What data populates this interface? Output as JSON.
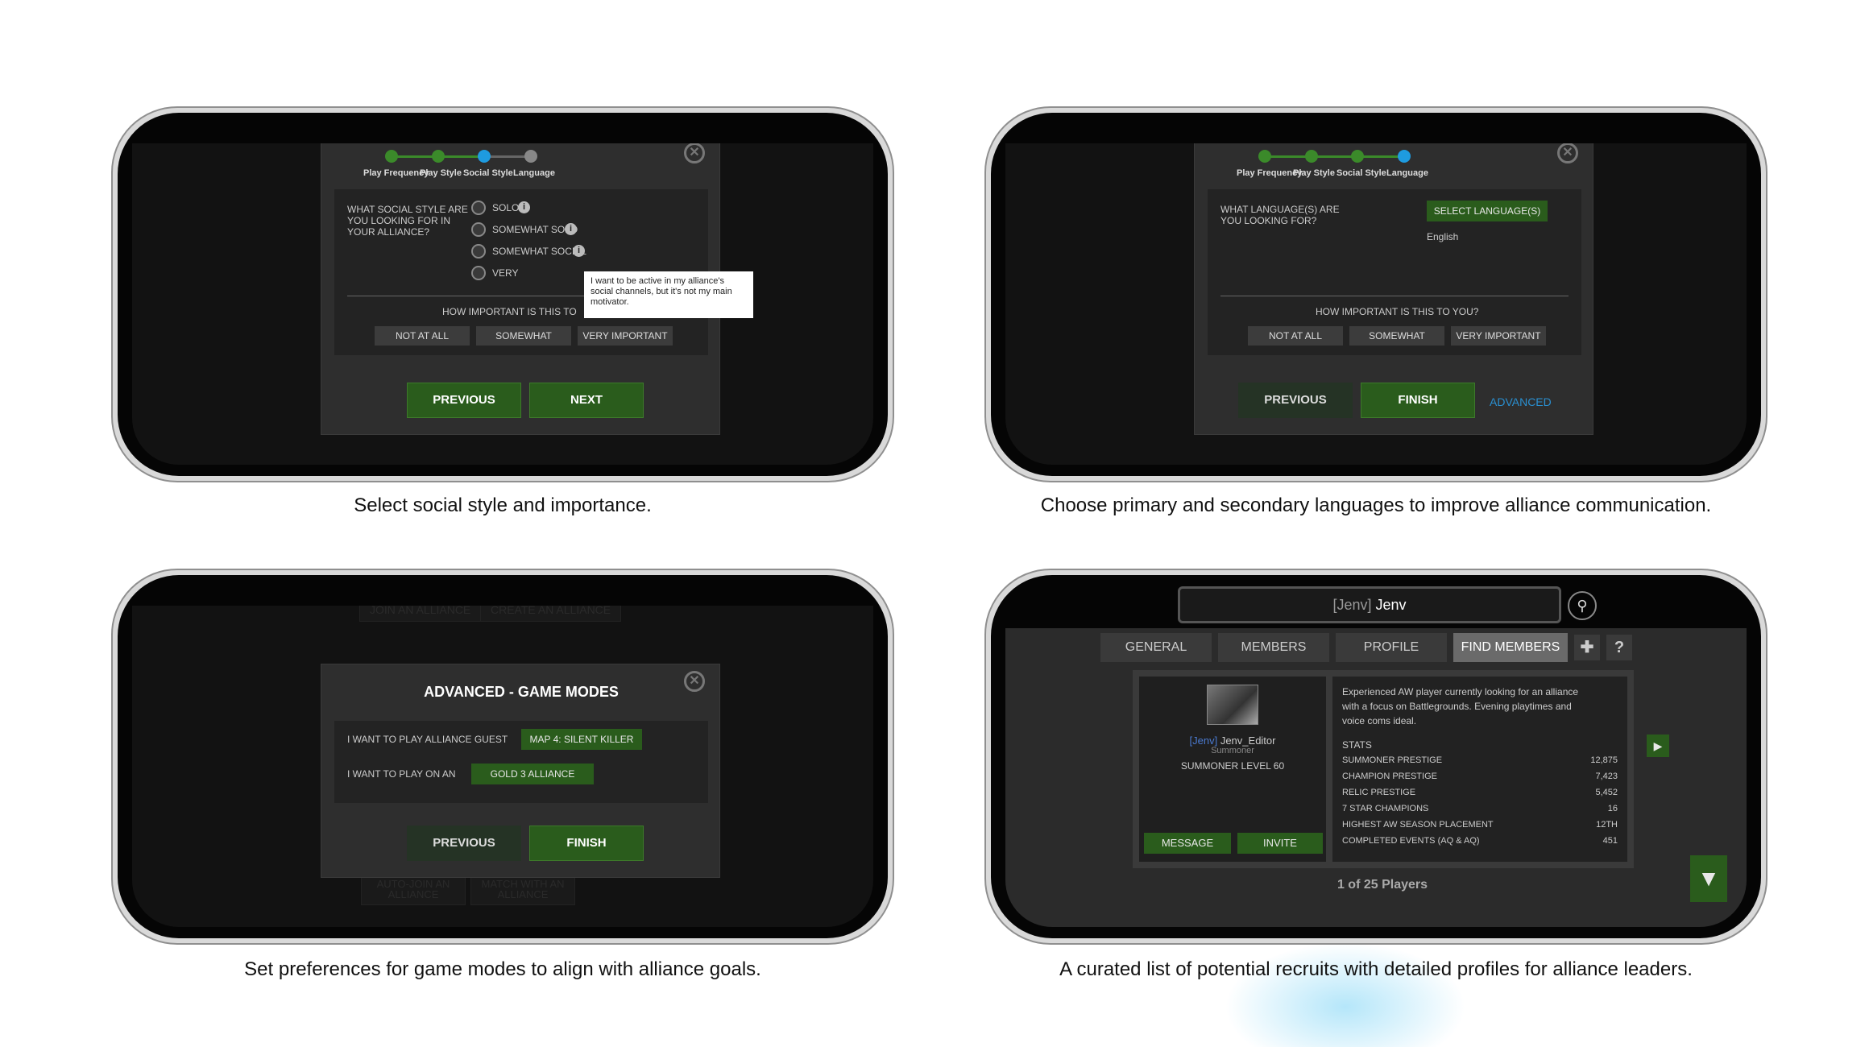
{
  "captions": [
    "Select social style and importance.",
    "Choose primary and secondary languages to improve alliance communication.",
    "Set preferences for game modes to align with alliance goals.",
    "A curated list of potential recruits with detailed profiles for alliance leaders."
  ],
  "background_tabs": {
    "join": "JOIN AN ALLIANCE",
    "create": "CREATE AN ALLIANCE",
    "auto_join": "AUTO-JOIN AN ALLIANCE",
    "match": "MATCH WITH AN ALLIANCE"
  },
  "steps": [
    "Play Frequency",
    "Play Style",
    "Social Style",
    "Language"
  ],
  "social": {
    "question": "WHAT SOCIAL STYLE ARE YOU LOOKING FOR IN YOUR ALLIANCE?",
    "options": [
      "SOLO",
      "SOMEWHAT SOLO",
      "SOMEWHAT SOCIAL",
      "VERY"
    ],
    "tooltip": "I want to be active in my alliance's social channels, but it's not my main motivator.",
    "importance_label": "HOW IMPORTANT IS THIS TO",
    "importance": [
      "NOT AT ALL",
      "SOMEWHAT",
      "VERY IMPORTANT"
    ],
    "previous": "PREVIOUS",
    "next": "NEXT"
  },
  "language": {
    "question": "WHAT LANGUAGE(S) ARE YOU LOOKING FOR?",
    "select_button": "SELECT LANGUAGE(S)",
    "selected": "English",
    "importance_label": "HOW IMPORTANT IS THIS TO YOU?",
    "importance": [
      "NOT AT ALL",
      "SOMEWHAT",
      "VERY IMPORTANT"
    ],
    "previous": "PREVIOUS",
    "finish": "FINISH",
    "advanced": "ADVANCED"
  },
  "advanced": {
    "title": "ADVANCED - GAME MODES",
    "row1_label": "I WANT TO PLAY ALLIANCE GUEST",
    "row1_value": "MAP 4: SILENT KILLER",
    "row2_label": "I WANT TO PLAY ON AN",
    "row2_value": "GOLD 3 ALLIANCE",
    "previous": "PREVIOUS",
    "finish": "FINISH"
  },
  "recruits": {
    "tag": "[Jenv]",
    "name": "Jenv",
    "tabs": [
      "GENERAL",
      "MEMBERS",
      "PROFILE",
      "FIND MEMBERS"
    ],
    "player_tag": "[Jenv]",
    "player_name": "Jenv_Editor",
    "role": "Summoner",
    "level": "SUMMONER LEVEL 60",
    "message": "MESSAGE",
    "invite": "INVITE",
    "bio": "Experienced AW player currently looking for an alliance with a focus on Battlegrounds. Evening playtimes and voice coms ideal.",
    "stats_title": "STATS",
    "stats": [
      {
        "label": "SUMMONER PRESTIGE",
        "value": "12,875"
      },
      {
        "label": "CHAMPION PRESTIGE",
        "value": "7,423"
      },
      {
        "label": "RELIC PRESTIGE",
        "value": "5,452"
      },
      {
        "label": "7 STAR CHAMPIONS",
        "value": "16"
      },
      {
        "label": "HIGHEST AW SEASON PLACEMENT",
        "value": "12TH"
      },
      {
        "label": "COMPLETED EVENTS (AQ & AQ)",
        "value": "451"
      }
    ],
    "pager": "1 of 25 Players"
  },
  "colors": {
    "accent_green": "#2a5c1c",
    "step_blue": "#1e9be0",
    "link_blue": "#2a8fd0"
  }
}
